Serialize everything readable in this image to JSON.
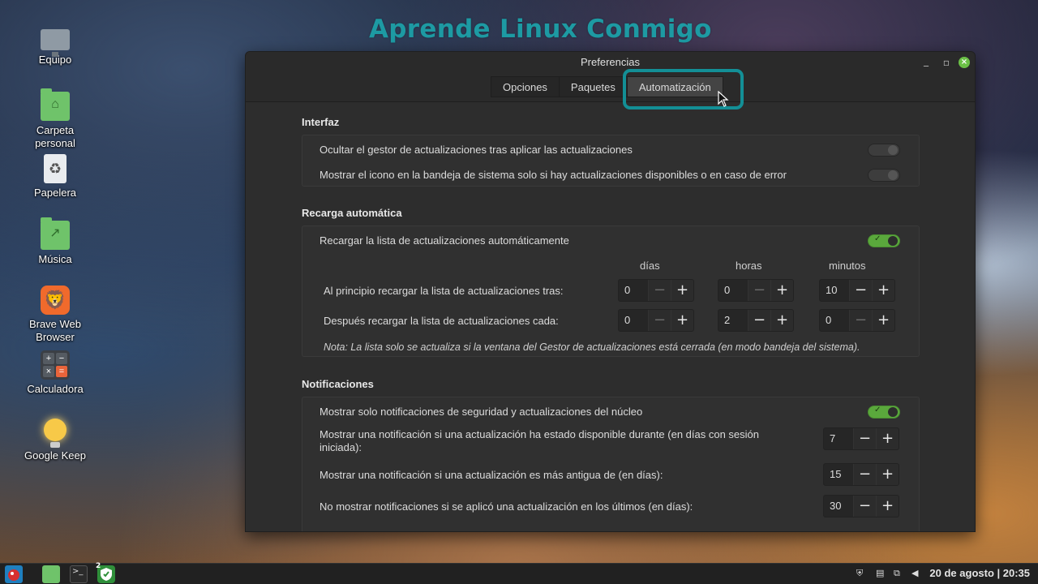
{
  "watermark": "Aprende Linux Conmigo",
  "desktop": {
    "icons": [
      {
        "label": "Equipo",
        "icon": "computer-icon"
      },
      {
        "label": "Carpeta\npersonal",
        "icon": "home-folder-icon"
      },
      {
        "label": "Papelera",
        "icon": "trash-icon"
      },
      {
        "label": "Música",
        "icon": "music-folder-icon"
      },
      {
        "label": "Brave Web\nBrowser",
        "icon": "brave-icon"
      },
      {
        "label": "Calculadora",
        "icon": "calculator-icon"
      },
      {
        "label": "Google Keep",
        "icon": "keep-bulb-icon"
      }
    ]
  },
  "window": {
    "title": "Preferencias",
    "tabs": [
      {
        "label": "Opciones"
      },
      {
        "label": "Paquetes"
      },
      {
        "label": "Automatización",
        "active": true
      }
    ],
    "sections": {
      "interfaz": {
        "title": "Interfaz",
        "rows": [
          {
            "label": "Ocultar el gestor de actualizaciones tras aplicar las actualizaciones",
            "enabled": false
          },
          {
            "label": "Mostrar el icono en la bandeja de sistema solo si hay actualizaciones disponibles o en caso de error",
            "enabled": false
          }
        ]
      },
      "recarga": {
        "title": "Recarga automática",
        "toggle_label": "Recargar la lista de actualizaciones automáticamente",
        "toggle_enabled": true,
        "columns": {
          "days": "días",
          "hours": "horas",
          "minutes": "minutos"
        },
        "initial": {
          "label": "Al principio recargar la lista de actualizaciones tras:",
          "days": "0",
          "hours": "0",
          "minutes": "10"
        },
        "interval": {
          "label": "Después recargar la lista de actualizaciones cada:",
          "days": "0",
          "hours": "2",
          "minutes": "0"
        },
        "note": "Nota: La lista solo se actualiza si la ventana del Gestor de actualizaciones está cerrada (en modo bandeja del sistema)."
      },
      "notificaciones": {
        "title": "Notificaciones",
        "security_only": {
          "label": "Mostrar solo notificaciones de seguridad y actualizaciones del núcleo",
          "enabled": true
        },
        "available_days": {
          "label": "Mostrar una notificación si una actualización ha estado disponible durante (en días con sesión iniciada):",
          "value": "7"
        },
        "older_days": {
          "label": "Mostrar una notificación si una actualización es más antigua de (en días):",
          "value": "15"
        },
        "suppress_days": {
          "label": "No mostrar notificaciones si se aplicó una actualización en los últimos (en días):",
          "value": "30"
        }
      }
    },
    "spin_minus": "−",
    "spin_plus": "+"
  },
  "taskbar": {
    "badge_count": "2",
    "clock": "20 de agosto | 20:35"
  },
  "colors": {
    "accent_switch": "#5aa83c",
    "highlight": "#138f96",
    "watermark": "#1d9aa3"
  }
}
